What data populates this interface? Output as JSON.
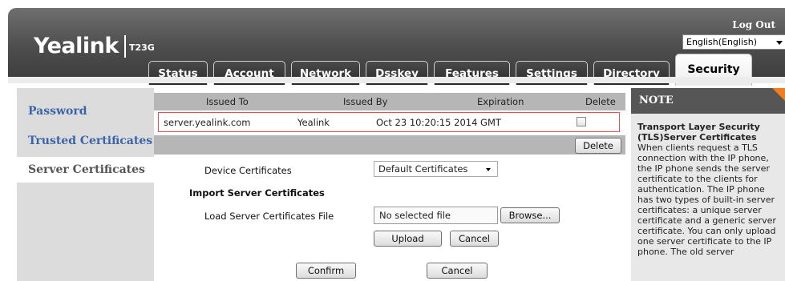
{
  "header": {
    "logo": "Yealink",
    "model": "T23G",
    "logout": "Log Out",
    "language": "English(English)"
  },
  "tabs": [
    {
      "label": "Status"
    },
    {
      "label": "Account"
    },
    {
      "label": "Network"
    },
    {
      "label": "Dsskey"
    },
    {
      "label": "Features"
    },
    {
      "label": "Settings"
    },
    {
      "label": "Directory"
    },
    {
      "label": "Security",
      "active": true
    }
  ],
  "sidebar": {
    "items": [
      {
        "label": "Password"
      },
      {
        "label": "Trusted Certificates"
      },
      {
        "label": "Server Certificates",
        "active": true
      }
    ]
  },
  "table": {
    "headers": {
      "issued_to": "Issued To",
      "issued_by": "Issued By",
      "expiration": "Expiration",
      "delete": "Delete"
    },
    "rows": [
      {
        "issued_to": "server.yealink.com",
        "issued_by": "Yealink",
        "expiration": "Oct 23 10:20:15 2014 GMT",
        "checked": false
      }
    ],
    "delete_button": "Delete"
  },
  "form": {
    "device_certificates_label": "Device Certificates",
    "device_certificates_value": "Default Certificates",
    "import_title": "Import Server Certificates",
    "load_file_label": "Load Server Certificates File",
    "file_placeholder": "No selected file",
    "browse_button": "Browse...",
    "upload_button": "Upload",
    "cancel_button": "Cancel",
    "confirm_button": "Confirm",
    "cancel_bottom_button": "Cancel"
  },
  "note": {
    "heading": "NOTE",
    "title": "Transport Layer Security (TLS)Server Certificates",
    "body": "When clients request a TLS connection with the IP phone, the IP phone sends the server certificate to the clients for authentication. The IP phone has two types of built-in server certificates: a unique server certificate and a generic server certificate. You can only upload one server certificate to the IP phone. The old server"
  },
  "colors": {
    "accent_tab_active": "#ffffff",
    "sidebar_link": "#3a64a8",
    "selected_row_border": "#e65252",
    "note_corner": "#f07e1e"
  }
}
